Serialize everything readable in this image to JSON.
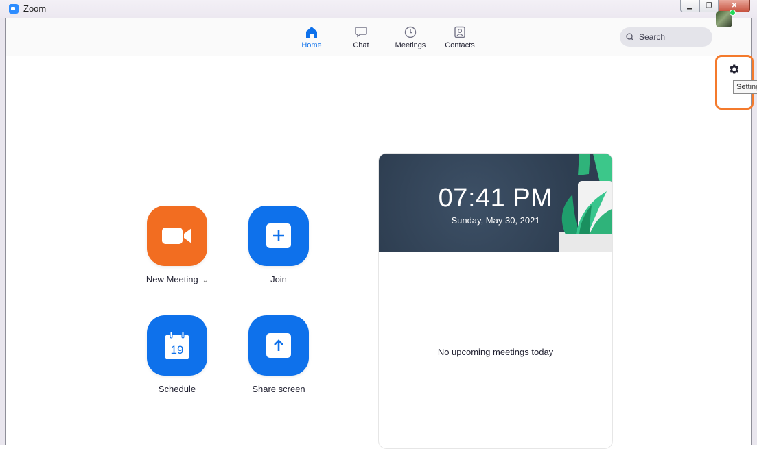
{
  "window": {
    "title": "Zoom",
    "minimize": "▁",
    "maximize": "❐",
    "close": "✕"
  },
  "nav": {
    "tabs": [
      {
        "label": "Home",
        "icon": "home-icon",
        "active": true
      },
      {
        "label": "Chat",
        "icon": "chat-icon",
        "active": false
      },
      {
        "label": "Meetings",
        "icon": "clock-icon",
        "active": false
      },
      {
        "label": "Contacts",
        "icon": "contacts-icon",
        "active": false
      }
    ],
    "search_label": "Search"
  },
  "settings": {
    "icon": "gear-icon",
    "tooltip": "Settings"
  },
  "actions": {
    "new_meeting": "New Meeting",
    "join": "Join",
    "schedule": "Schedule",
    "schedule_day": "19",
    "share_screen": "Share screen"
  },
  "clock": {
    "time": "07:41 PM",
    "date": "Sunday, May 30, 2021",
    "empty_message": "No upcoming meetings today"
  },
  "colors": {
    "accent": "#0e71eb",
    "new_meeting": "#f26d21",
    "highlight": "#f47a2c",
    "card_header": "#2e3e51",
    "presence": "#23d959"
  }
}
